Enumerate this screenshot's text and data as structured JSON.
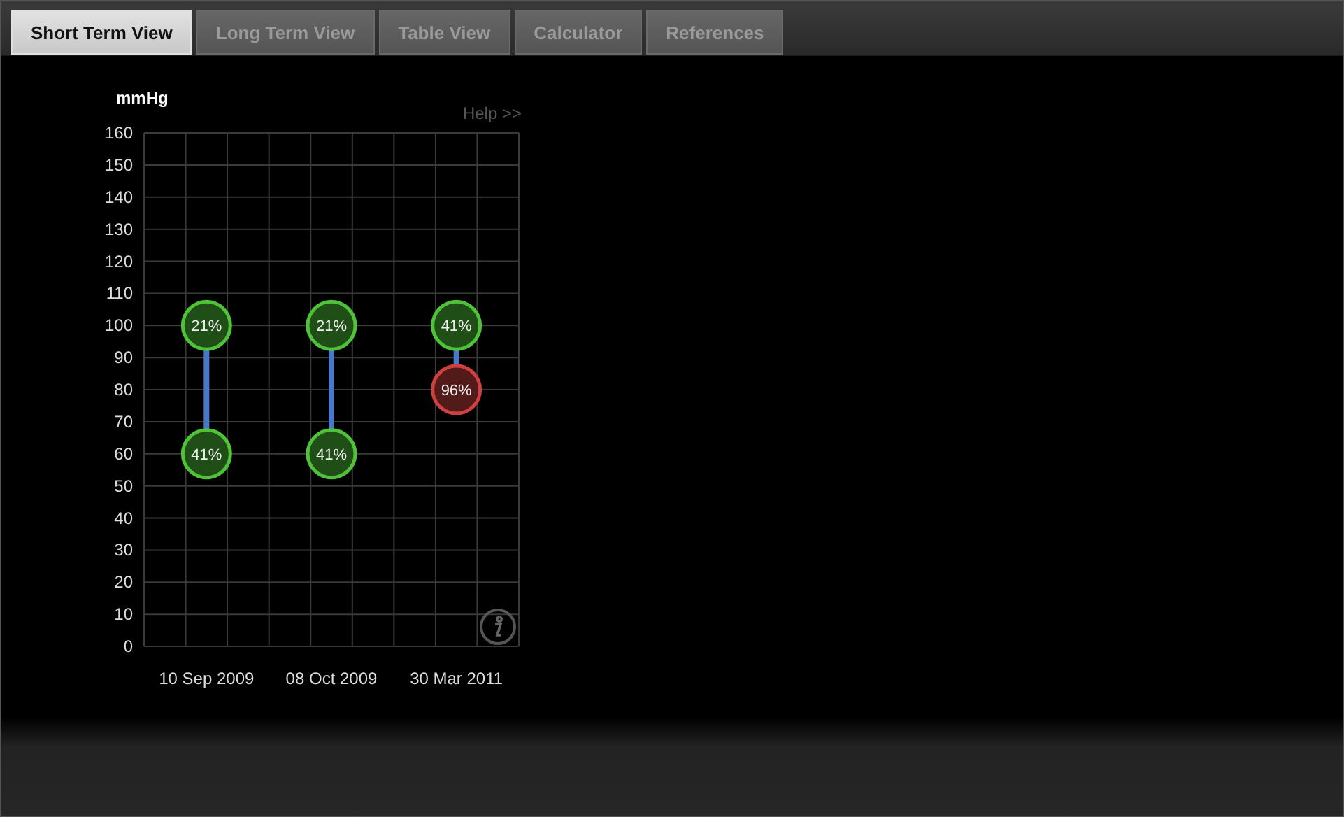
{
  "tabs": [
    {
      "label": "Short Term View",
      "selected": true
    },
    {
      "label": "Long Term View",
      "selected": false
    },
    {
      "label": "Table View",
      "selected": false
    },
    {
      "label": "Calculator",
      "selected": false
    },
    {
      "label": "References",
      "selected": false
    }
  ],
  "help_link": "Help >>",
  "chart_data": {
    "type": "scatter",
    "ylabel": "mmHg",
    "categories": [
      "10 Sep 2009",
      "08 Oct 2009",
      "30 Mar 2011"
    ],
    "ylim": [
      0,
      160
    ],
    "yticks": [
      0,
      10,
      20,
      30,
      40,
      50,
      60,
      70,
      80,
      90,
      100,
      110,
      120,
      130,
      140,
      150,
      160
    ],
    "grid": true,
    "series": [
      {
        "color": "#4fc23a",
        "values": [
          100,
          100,
          100
        ]
      },
      {
        "color": "#4fc23a",
        "values": [
          60,
          60,
          null
        ]
      },
      {
        "color": "#d04040",
        "values": [
          null,
          null,
          80
        ]
      }
    ],
    "annotations": [
      {
        "x": "10 Sep 2009",
        "y": 100,
        "text": "21%"
      },
      {
        "x": "08 Oct 2009",
        "y": 100,
        "text": "21%"
      },
      {
        "x": "30 Mar 2011",
        "y": 100,
        "text": "41%"
      },
      {
        "x": "10 Sep 2009",
        "y": 60,
        "text": "41%"
      },
      {
        "x": "08 Oct 2009",
        "y": 60,
        "text": "41%"
      },
      {
        "x": "30 Mar 2011",
        "y": 80,
        "text": "96%"
      }
    ]
  }
}
